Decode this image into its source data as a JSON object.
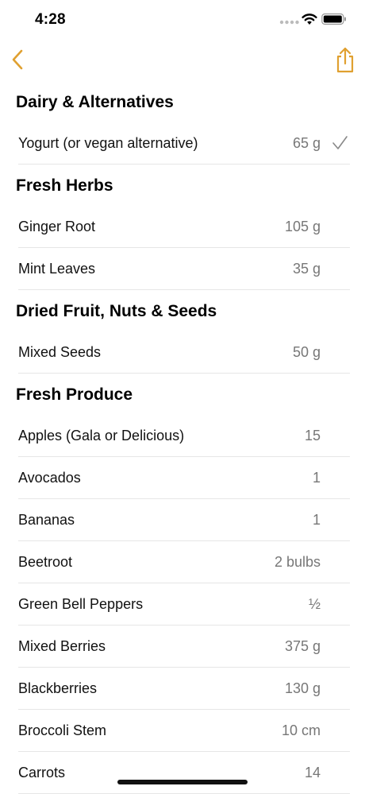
{
  "status_bar": {
    "time": "4:28"
  },
  "colors": {
    "accent": "#E0A030",
    "secondary_text": "#777777",
    "divider": "#E6E6E6"
  },
  "icons": {
    "back": "chevron-left-icon",
    "share": "share-icon",
    "check": "checkmark-icon"
  },
  "sections": [
    {
      "title": "Dairy & Alternatives",
      "items": [
        {
          "name": "Yogurt (or vegan alternative)",
          "qty": "65 g",
          "checked": true
        }
      ]
    },
    {
      "title": "Fresh Herbs",
      "items": [
        {
          "name": "Ginger Root",
          "qty": "105 g"
        },
        {
          "name": "Mint Leaves",
          "qty": "35 g"
        }
      ]
    },
    {
      "title": "Dried Fruit, Nuts & Seeds",
      "items": [
        {
          "name": "Mixed Seeds",
          "qty": "50 g"
        }
      ]
    },
    {
      "title": "Fresh Produce",
      "items": [
        {
          "name": "Apples (Gala or Delicious)",
          "qty": "15"
        },
        {
          "name": "Avocados",
          "qty": "1"
        },
        {
          "name": "Bananas",
          "qty": "1"
        },
        {
          "name": "Beetroot",
          "qty": "2 bulbs"
        },
        {
          "name": "Green Bell Peppers",
          "qty": "½"
        },
        {
          "name": "Mixed Berries",
          "qty": "375 g"
        },
        {
          "name": "Blackberries",
          "qty": "130 g"
        },
        {
          "name": "Broccoli Stem",
          "qty": "10 cm"
        },
        {
          "name": "Carrots",
          "qty": "14"
        }
      ]
    }
  ]
}
